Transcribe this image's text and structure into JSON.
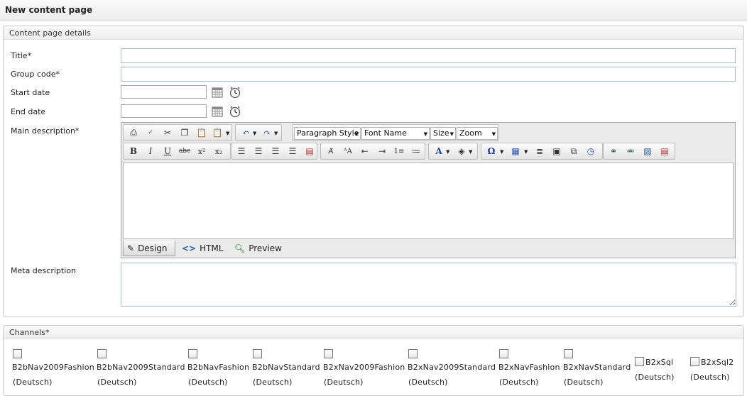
{
  "page": {
    "title": "New content page"
  },
  "details": {
    "legend": "Content page details",
    "fields": {
      "title_label": "Title*",
      "title_value": "",
      "group_code_label": "Group code*",
      "group_code_value": "",
      "start_date_label": "Start date",
      "start_date_value": "",
      "end_date_label": "End date",
      "end_date_value": "",
      "main_description_label": "Main description*",
      "meta_description_label": "Meta description",
      "meta_description_value": ""
    }
  },
  "editor": {
    "paragraph_style": "Paragraph Style",
    "font_name": "Font Name",
    "size": "Size",
    "zoom": "Zoom",
    "modes": {
      "design": "Design",
      "html": "HTML",
      "preview": "Preview"
    },
    "row1_icons": [
      "print-icon",
      "spellcheck-icon",
      "cut-icon",
      "copy-icon",
      "paste-icon",
      "paste-options-icon",
      "undo-icon",
      "redo-icon"
    ],
    "row2_icons": [
      "bold-icon",
      "italic-icon",
      "underline-icon",
      "strikethrough-icon",
      "superscript-icon",
      "subscript-icon",
      "align-left-icon",
      "align-center-icon",
      "align-right-icon",
      "justify-icon",
      "indent-icon",
      "format-stripper-icon",
      "convert-case-icon",
      "outdent-icon",
      "indent-increase-icon",
      "numbered-list-icon",
      "bullet-list-icon",
      "font-color-icon",
      "highlight-icon",
      "symbol-icon",
      "table-icon",
      "paragraph-icon",
      "template-icon",
      "insert-snippet-icon",
      "insert-date-icon",
      "hyperlink-icon",
      "remove-link-icon",
      "image-manager-icon",
      "document-manager-icon"
    ]
  },
  "channels": {
    "legend": "Channels*",
    "items": [
      {
        "name": "B2bNav2009Fashion",
        "lang": "(Deutsch)",
        "checked": false
      },
      {
        "name": "B2bNav2009Standard",
        "lang": "(Deutsch)",
        "checked": false
      },
      {
        "name": "B2bNavFashion",
        "lang": "(Deutsch)",
        "checked": false
      },
      {
        "name": "B2bNavStandard",
        "lang": "(Deutsch)",
        "checked": false
      },
      {
        "name": "B2xNav2009Fashion",
        "lang": "(Deutsch)",
        "checked": false
      },
      {
        "name": "B2xNav2009Standard",
        "lang": "(Deutsch)",
        "checked": false
      },
      {
        "name": "B2xNavFashion",
        "lang": "(Deutsch)",
        "checked": false
      },
      {
        "name": "B2xNavStandard",
        "lang": "(Deutsch)",
        "checked": false
      },
      {
        "name": "B2xSql",
        "lang": "(Deutsch)",
        "checked": false
      },
      {
        "name": "B2xSql2",
        "lang": "(Deutsch)",
        "checked": false
      }
    ]
  },
  "colors": {
    "input_border": "#a7bccc",
    "panel_border": "#c9c9c9",
    "toolbar_bg": "#ebebeb"
  }
}
